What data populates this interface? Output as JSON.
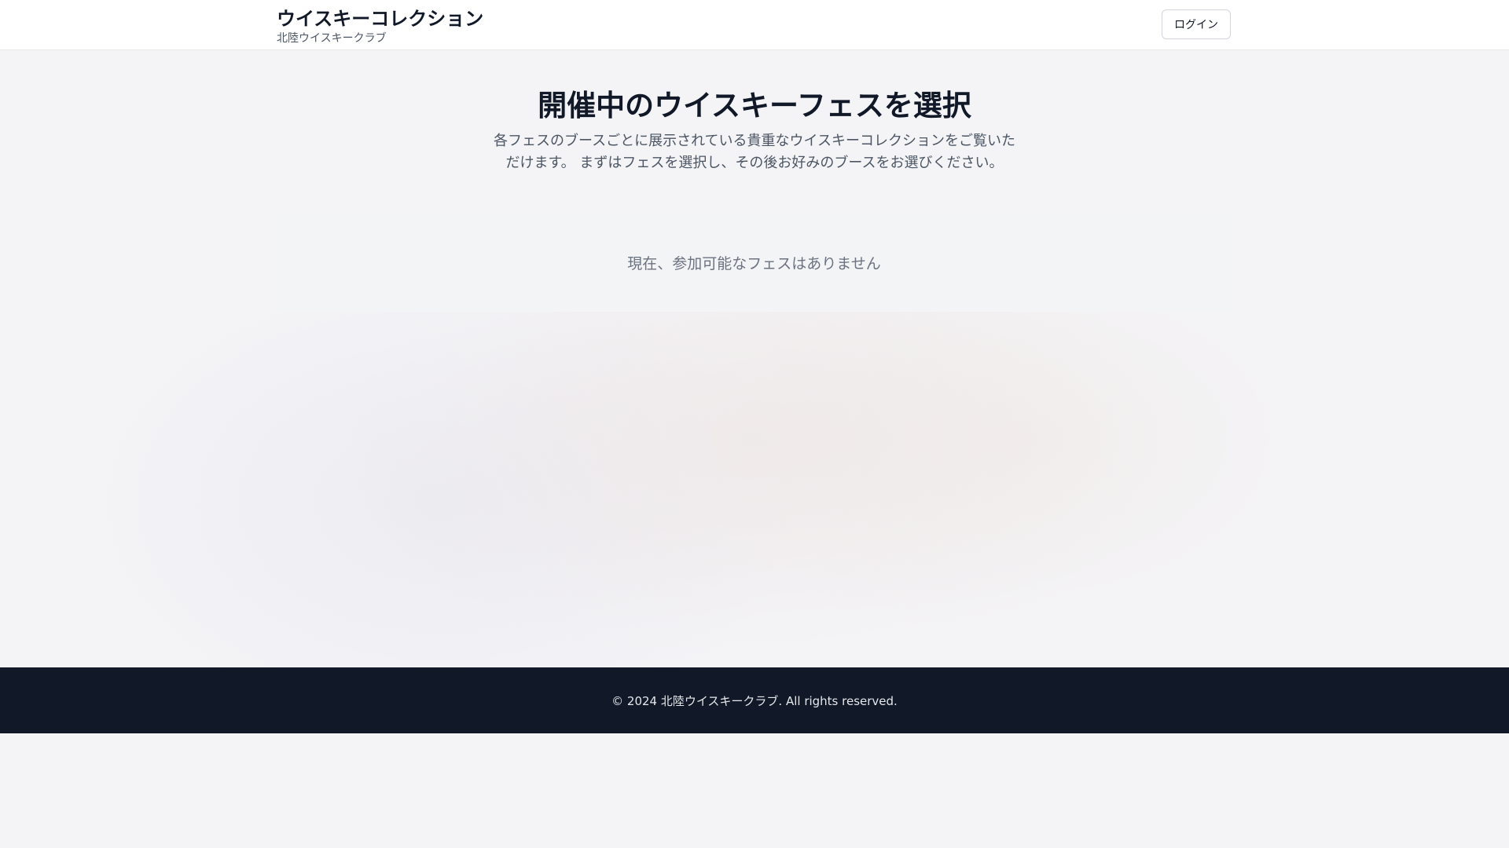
{
  "header": {
    "title": "ウイスキーコレクション",
    "subtitle": "北陸ウイスキークラブ",
    "login_label": "ログイン"
  },
  "main": {
    "heading": "開催中のウイスキーフェスを選択",
    "description": "各フェスのブースごとに展示されている貴重なウイスキーコレクションをご覧いただけます。 まずはフェスを選択し、その後お好みのブースをお選びください。",
    "empty_message": "現在、参加可能なフェスはありません"
  },
  "footer": {
    "copyright": "© 2024 北陸ウイスキークラブ. All rights reserved."
  },
  "colors": {
    "header_bg": "#ffffff",
    "footer_bg": "#111827",
    "panel_bg": "#f3f4f6",
    "text_primary": "#111827",
    "text_muted": "#6b7280"
  }
}
